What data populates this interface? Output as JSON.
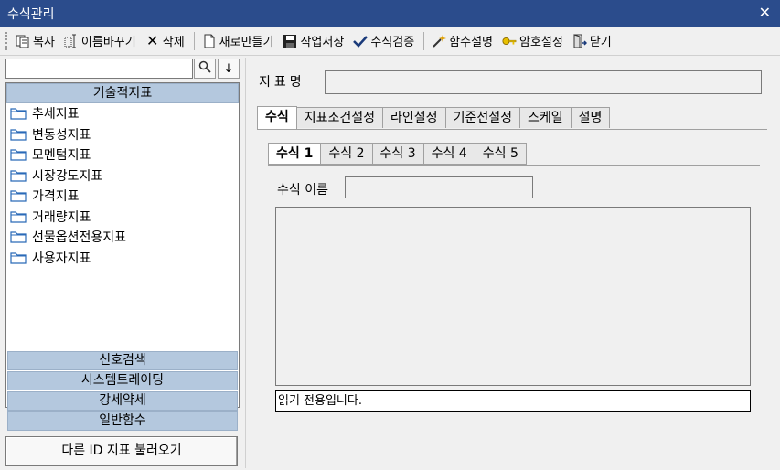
{
  "window": {
    "title": "수식관리",
    "close": "✕"
  },
  "toolbar": {
    "copy": "복사",
    "rename": "이름바꾸기",
    "delete": "삭제",
    "new": "새로만들기",
    "save": "작업저장",
    "verify": "수식검증",
    "func_help": "함수설명",
    "password": "암호설정",
    "close": "닫기"
  },
  "left": {
    "search_value": "",
    "search_icon": "🔍",
    "down_icon": "↓",
    "category_header": "기술적지표",
    "tree_items": [
      "추세지표",
      "변동성지표",
      "모멘텀지표",
      "시장강도지표",
      "가격지표",
      "거래량지표",
      "선물옵션전용지표",
      "사용자지표"
    ],
    "categories": [
      "신호검색",
      "시스템트레이딩",
      "강세약세",
      "일반함수"
    ],
    "load_button": "다른 ID 지표 불러오기"
  },
  "right": {
    "name_label": "지표명",
    "name_value": "",
    "tabs": [
      "수식",
      "지표조건설정",
      "라인설정",
      "기준선설정",
      "스케일",
      "설명"
    ],
    "active_tab": 0,
    "subtabs": [
      "수식 1",
      "수식 2",
      "수식 3",
      "수식 4",
      "수식 5"
    ],
    "active_subtab": 0,
    "formula_name_label": "수식 이름",
    "formula_name_value": "",
    "editor_content": "",
    "status_text": "읽기 전용입니다."
  }
}
